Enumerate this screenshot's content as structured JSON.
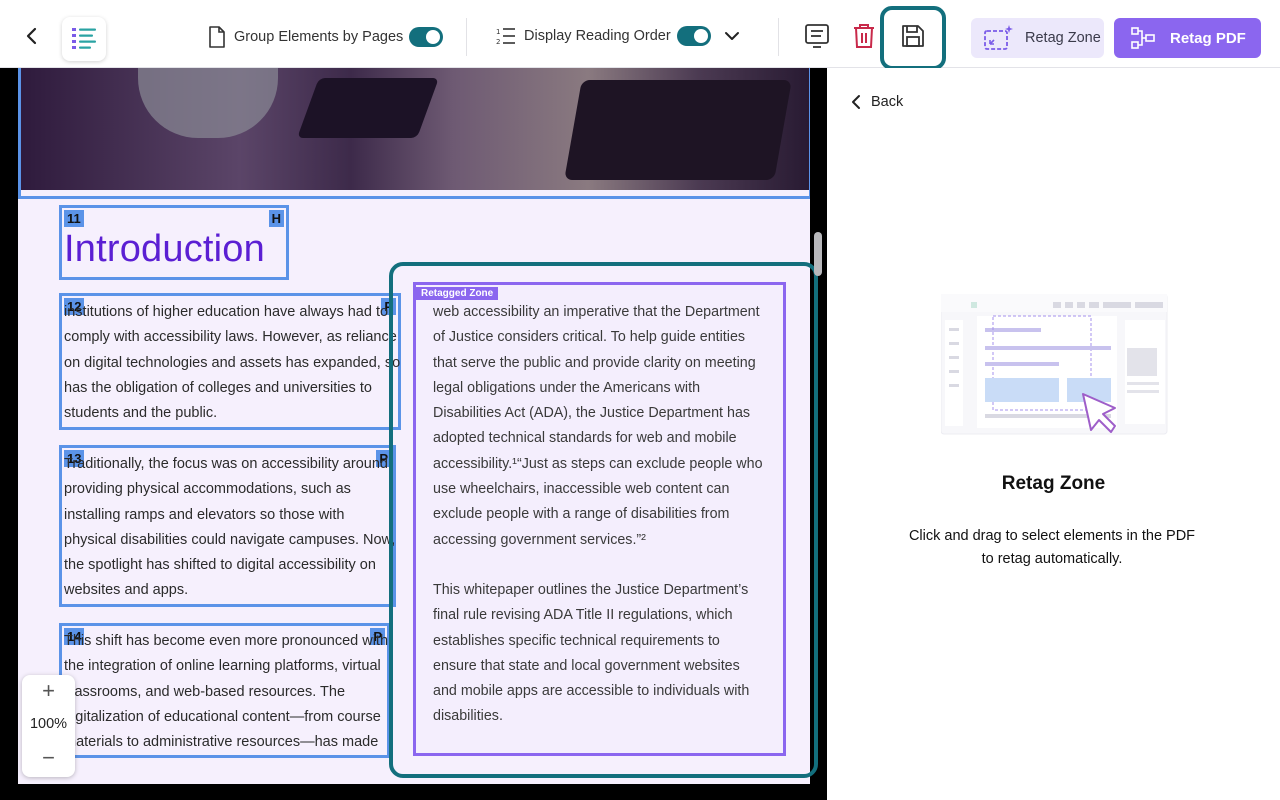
{
  "toolbar": {
    "group_elements_label": "Group Elements by Pages",
    "display_reading_order_label": "Display Reading Order",
    "retag_zone_label": "Retag Zone",
    "retag_pdf_label": "Retag PDF",
    "icons": [
      "chevron-left-icon",
      "tag-list-icon",
      "page-icon",
      "ordered-list-icon",
      "chevron-down-icon",
      "text-panel-icon",
      "trash-icon",
      "save-icon",
      "retag-zone-icon",
      "retag-pdf-icon"
    ],
    "accent": "#136f7d",
    "brand": "#8b66ef"
  },
  "document": {
    "heading": {
      "num": "11",
      "type": "H",
      "text": "Introduction"
    },
    "para12": {
      "num": "12",
      "type": "P",
      "lines": [
        "institutions of higher education have always had to",
        "comply with accessibility laws. However, as reliance",
        "on digital technologies and assets has expanded, so",
        "has the obligation of colleges and universities to",
        "students and the public."
      ]
    },
    "para13": {
      "num": "13",
      "type": "P",
      "lines": [
        "Traditionally, the focus was on accessibility around",
        "providing physical accommodations, such as",
        "installing ramps and elevators so those with",
        "physical disabilities could navigate campuses. Now,",
        "the spotlight has shifted to digital accessibility on",
        "websites and apps."
      ]
    },
    "para14": {
      "num": "14",
      "type": "P",
      "lines": [
        "This shift has become even more pronounced with",
        "the integration of online learning platforms, virtual",
        "classrooms, and web-based resources. The",
        "digitalization of educational content—from course",
        "materials to administrative resources—has made"
      ]
    },
    "retagged_zone": {
      "label": "Retagged Zone",
      "lines": [
        "web accessibility an imperative that the Department",
        "of Justice considers critical. To help guide entities",
        "that serve the public and provide clarity on meeting",
        "legal obligations under the Americans with",
        "Disabilities Act (ADA), the Justice Department has",
        "adopted technical standards for web and mobile",
        "accessibility.¹“Just as steps can exclude people who",
        "use wheelchairs, inaccessible web content can",
        "exclude people with a range of disabilities from",
        "accessing government services.”²",
        "",
        "This whitepaper outlines the Justice Department’s",
        "final rule revising ADA Title II regulations, which",
        "establishes specific technical requirements to",
        "ensure that state and local government websites",
        "and mobile apps are accessible to individuals with",
        "disabilities."
      ]
    }
  },
  "zoom": {
    "plus": "+",
    "level": "100%",
    "minus": "−"
  },
  "panel": {
    "back_label": "Back",
    "title": "Retag Zone",
    "description": "Click and drag to select elements in the PDF to retag automatically."
  }
}
